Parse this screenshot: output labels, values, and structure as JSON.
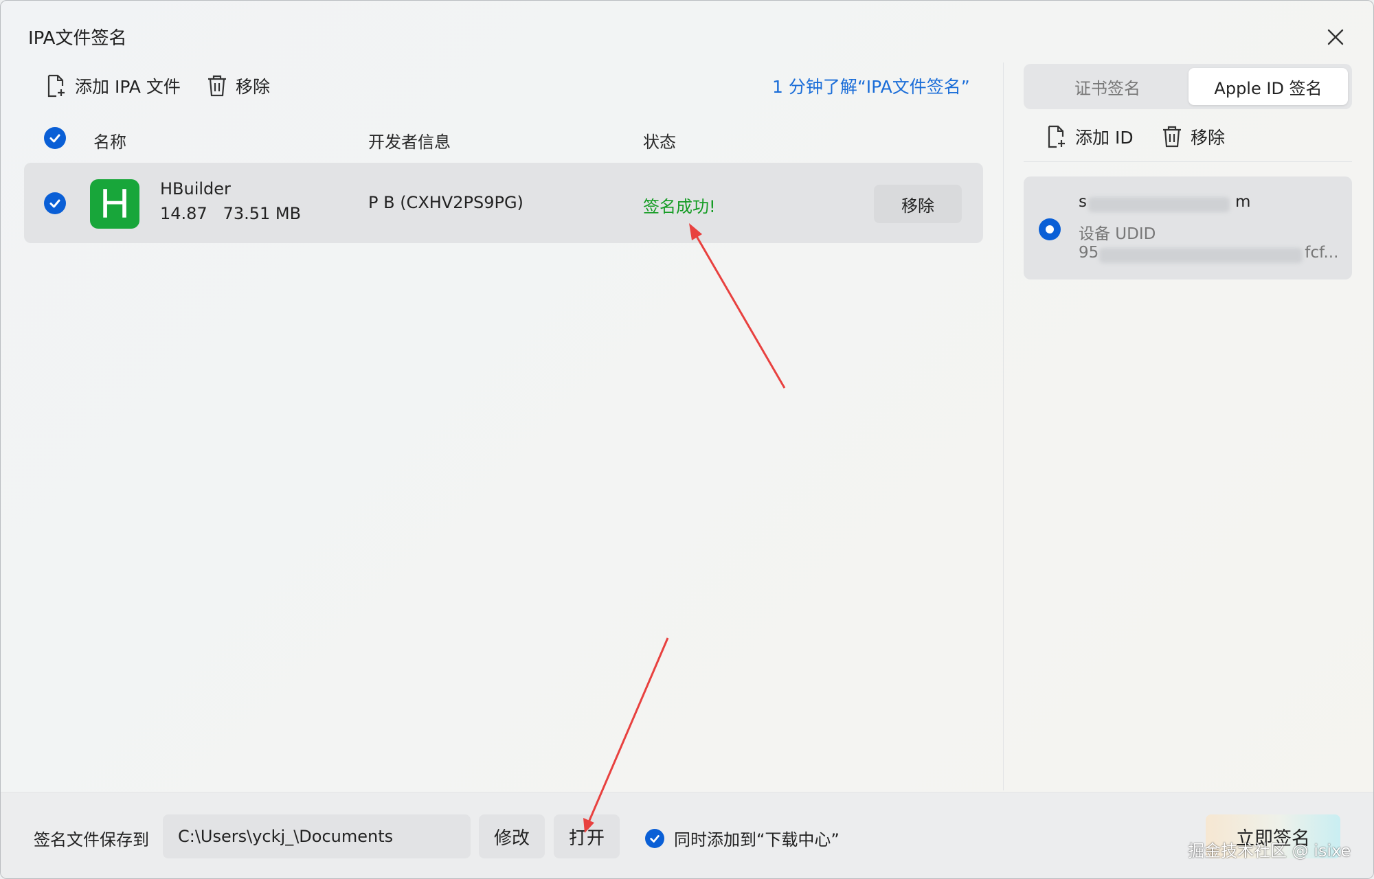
{
  "window": {
    "title": "IPA文件签名"
  },
  "toolbar": {
    "add_ipa_label": "添加 IPA 文件",
    "remove_label": "移除",
    "learn_link": "1 分钟了解“IPA文件签名”"
  },
  "table": {
    "headers": {
      "name": "名称",
      "developer": "开发者信息",
      "status": "状态"
    },
    "rows": [
      {
        "icon_letter": "H",
        "name": "HBuilder",
        "size": "14.87   73.51 MB",
        "developer": "P B (CXHV2PS9PG)",
        "status": "签名成功!",
        "remove_label": "移除"
      }
    ]
  },
  "right_panel": {
    "tabs": [
      {
        "label": "证书签名",
        "active": false
      },
      {
        "label": "Apple ID 签名",
        "active": true
      }
    ],
    "add_id_label": "添加 ID",
    "remove_label": "移除",
    "id_card": {
      "email_start": "s",
      "email_end": "m",
      "udid_label": "设备 UDID",
      "udid_start": "95",
      "udid_end": "fcf..."
    }
  },
  "bottom": {
    "save_label": "签名文件保存到",
    "path_value": "C:\\Users\\yckj_\\Documents",
    "modify_label": "修改",
    "open_label": "打开",
    "download_center_label": "同时添加到“下载中心”",
    "sign_now_label": "立即签名"
  },
  "watermark": "掘金技术社区 @ isixe",
  "colors": {
    "accent": "#0a5fd6",
    "success": "#159c24",
    "link": "#1a6dd8",
    "app_icon": "#18a63a",
    "annotation_arrow": "#e8413f"
  }
}
